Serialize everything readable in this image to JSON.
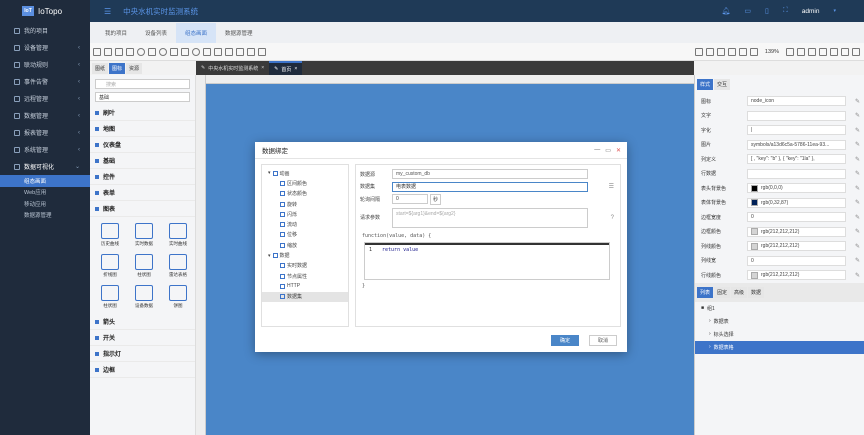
{
  "app": {
    "logo_badge": "IoT",
    "name": "IoTopo",
    "system_title": "中央水机实时监测系统",
    "user": "admin"
  },
  "nav": {
    "items": [
      {
        "label": "我的项目",
        "icon": "grid-icon",
        "arrow": ""
      },
      {
        "label": "设备管理",
        "icon": "device-icon",
        "arrow": "<"
      },
      {
        "label": "联动规则",
        "icon": "rule-icon",
        "arrow": "<"
      },
      {
        "label": "事件告警",
        "icon": "alarm-icon",
        "arrow": "<"
      },
      {
        "label": "远程管理",
        "icon": "remote-icon",
        "arrow": "<"
      },
      {
        "label": "数据管理",
        "icon": "data-icon",
        "arrow": "<"
      },
      {
        "label": "报表管理",
        "icon": "report-icon",
        "arrow": "<"
      },
      {
        "label": "系统管理",
        "icon": "settings-icon",
        "arrow": "<"
      },
      {
        "label": "数据可视化",
        "icon": "chart-icon",
        "arrow": "v"
      }
    ],
    "sub_items": [
      "组态画面",
      "Web应用",
      "移动应用",
      "数据源管理"
    ]
  },
  "tabs": [
    "我的项目",
    "设备列表",
    "组态画面",
    "数据源管理"
  ],
  "toolbar": {
    "zoom": "139%"
  },
  "left_tabs": [
    "图纸",
    "图标",
    "资源"
  ],
  "file_tabs": [
    {
      "label": "中央水机实时监测系统",
      "active": false
    },
    {
      "label": "首页",
      "active": true
    }
  ],
  "shape_panel": {
    "search_placeholder": "搜索",
    "select_value": "基础",
    "categories_top": [
      "刷叶",
      "地图",
      "仪表盘",
      "基础",
      "控件",
      "表单",
      "图表"
    ],
    "chart_cells": [
      "历史曲线",
      "实时数据",
      "实时曲线",
      "折线图",
      "柱状图",
      "雷达表格",
      "柱状图",
      "设备数据",
      "饼图"
    ],
    "categories_bottom": [
      "箭头",
      "开关",
      "指示灯",
      "边框"
    ]
  },
  "right_panel": {
    "tabs": [
      "样式",
      "交互"
    ],
    "rows": [
      {
        "label": "图标",
        "value": "node_icon",
        "swatch": ""
      },
      {
        "label": "文字",
        "value": "",
        "swatch": ""
      },
      {
        "label": "字化",
        "value": "|",
        "swatch": ""
      },
      {
        "label": "图片",
        "value": "symbols/a13d6c5a-5786-11ea-93...",
        "swatch": ""
      },
      {
        "label": "列定义",
        "value": "[ , \"key\": \"b\" }, { \"key\": \"1la\" },",
        "swatch": ""
      },
      {
        "label": "行数据",
        "value": "",
        "swatch": ""
      },
      {
        "label": "表头背景色",
        "value": "rgb(0,0,0)",
        "swatch": "#000000"
      },
      {
        "label": "表体背景色",
        "value": "rgb(0,32,87)",
        "swatch": "#002057"
      },
      {
        "label": "边框宽度",
        "value": "0",
        "swatch": ""
      },
      {
        "label": "边框颜色",
        "value": "rgb(212,212,212)",
        "swatch": "#d4d4d4"
      },
      {
        "label": "列线颜色",
        "value": "rgb(212,212,212)",
        "swatch": "#d4d4d4"
      },
      {
        "label": "列线宽",
        "value": "0",
        "swatch": ""
      },
      {
        "label": "行线颜色",
        "value": "rgb(212,212,212)",
        "swatch": "#d4d4d4"
      }
    ],
    "bottom_tabs": [
      "列表",
      "固定",
      "高级",
      "数据"
    ],
    "tree": [
      {
        "label": "组1",
        "active": false
      },
      {
        "label": "数据表",
        "active": false
      },
      {
        "label": "标头选择",
        "active": false
      },
      {
        "label": "数据表格",
        "active": true
      }
    ]
  },
  "modal": {
    "title": "数据绑定",
    "tree": [
      {
        "label": "动画",
        "indent": 1,
        "icon": "animation-icon"
      },
      {
        "label": "区间颜色",
        "indent": 2,
        "icon": "color-icon"
      },
      {
        "label": "状态颜色",
        "indent": 2,
        "icon": "state-icon"
      },
      {
        "label": "旋转",
        "indent": 2,
        "icon": "rotate-icon"
      },
      {
        "label": "闪烁",
        "indent": 2,
        "icon": "blink-icon"
      },
      {
        "label": "流动",
        "indent": 2,
        "icon": "flow-icon"
      },
      {
        "label": "位移",
        "indent": 2,
        "icon": "move-icon"
      },
      {
        "label": "缩放",
        "indent": 2,
        "icon": "scale-icon"
      },
      {
        "label": "数据",
        "indent": 1,
        "icon": "data-icon"
      },
      {
        "label": "实时数据",
        "indent": 2,
        "icon": "realtime-icon"
      },
      {
        "label": "节点属性",
        "indent": 2,
        "icon": "node-icon"
      },
      {
        "label": "HTTP",
        "indent": 2,
        "icon": "http-icon"
      },
      {
        "label": "数据集",
        "indent": 2,
        "icon": "dataset-icon"
      }
    ],
    "form": {
      "datasource_label": "数据源",
      "datasource_value": "my_custom_db",
      "dataset_label": "数据集",
      "dataset_value": "电表数据",
      "interval_label": "轮询间隔",
      "interval_value": "0",
      "interval_unit": "秒",
      "params_label": "请求参数",
      "params_placeholder": "start=${arg1}&end=${arg2}",
      "fn_header": "function(value, data) {",
      "line_no": "1",
      "code_line": "return value",
      "fn_footer": "}"
    },
    "ok_label": "确定",
    "cancel_label": "取消"
  }
}
